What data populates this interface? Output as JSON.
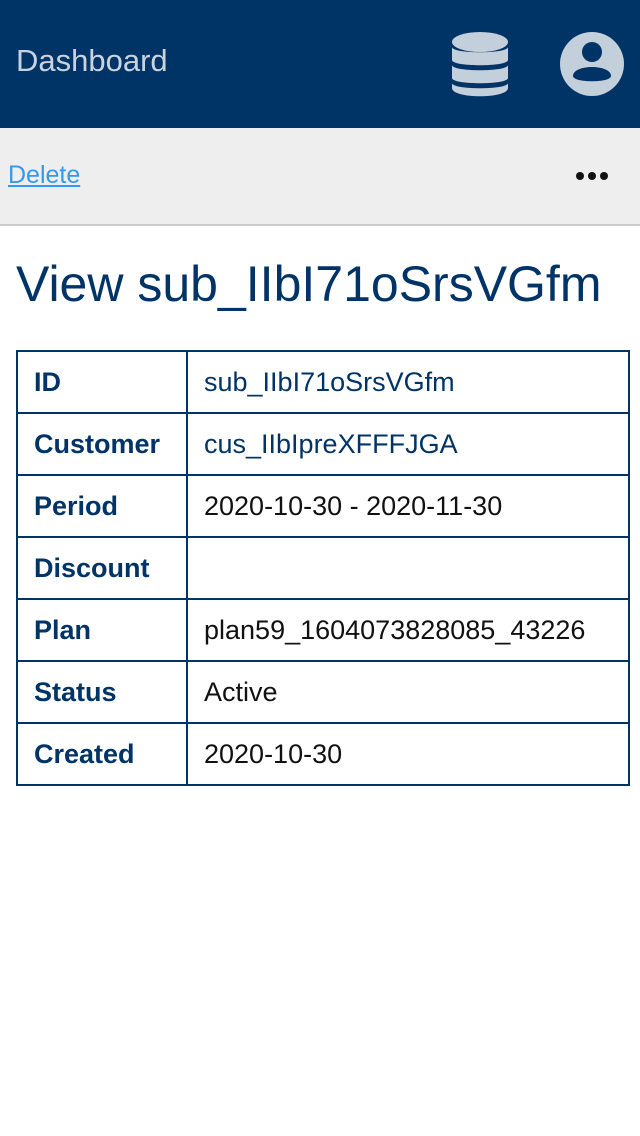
{
  "header": {
    "title": "Dashboard",
    "icons": [
      "database-icon",
      "user-account-icon"
    ],
    "background": "#003366"
  },
  "toolbar": {
    "delete_label": "Delete",
    "more_icon": "more-options-icon"
  },
  "page": {
    "title": "View sub_IIbI71oSrsVGfm"
  },
  "details": {
    "rows": [
      {
        "label": "ID",
        "value": "sub_IIbI71oSrsVGfm",
        "link": true
      },
      {
        "label": "Customer",
        "value": "cus_IIbIpreXFFFJGA",
        "link": true
      },
      {
        "label": "Period",
        "value": "2020-10-30 - 2020-11-30",
        "link": false
      },
      {
        "label": "Discount",
        "value": "",
        "link": false
      },
      {
        "label": "Plan",
        "value": "plan59_1604073828085_43226",
        "link": false
      },
      {
        "label": "Status",
        "value": "Active",
        "link": false
      },
      {
        "label": "Created",
        "value": "2020-10-30",
        "link": false
      }
    ]
  },
  "colors": {
    "primary": "#003366",
    "link": "#3399ee",
    "toolbar_bg": "#eeeeee"
  }
}
